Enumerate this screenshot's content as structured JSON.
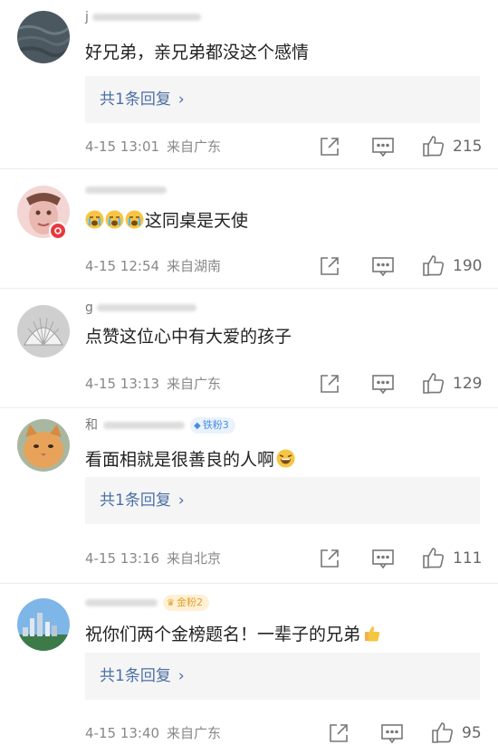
{
  "comments": [
    {
      "username": "j",
      "text": "好兄弟，亲兄弟都没这个感情",
      "reply_label": "共1条回复",
      "time": "4-15 13:01",
      "location": "来自广东",
      "likes": "215"
    },
    {
      "username": "",
      "text": "这同桌是天使",
      "time": "4-15 12:54",
      "location": "来自湖南",
      "likes": "190"
    },
    {
      "username": "g",
      "text": "点赞这位心中有大爱的孩子",
      "time": "4-15 13:13",
      "location": "来自广东",
      "likes": "129"
    },
    {
      "username": "和",
      "fan_badge": "铁粉3",
      "text": "看面相就是很善良的人啊",
      "reply_label": "共1条回复",
      "time": "4-15 13:16",
      "location": "来自北京",
      "likes": "111"
    },
    {
      "username": "",
      "fan_badge": "金粉2",
      "text": "祝你们两个金榜题名！一辈子的兄弟",
      "reply_label": "共1条回复",
      "time": "4-15 13:40",
      "location": "来自广东",
      "likes": "95"
    }
  ],
  "icons": {
    "share": "share-icon",
    "comment": "comment-icon",
    "like": "thumbs-up-icon"
  },
  "colors": {
    "reply_text": "#4a6fa5",
    "reply_bg": "#f5f5f5",
    "meta": "#888888",
    "vip_badge": "#e8393d"
  }
}
